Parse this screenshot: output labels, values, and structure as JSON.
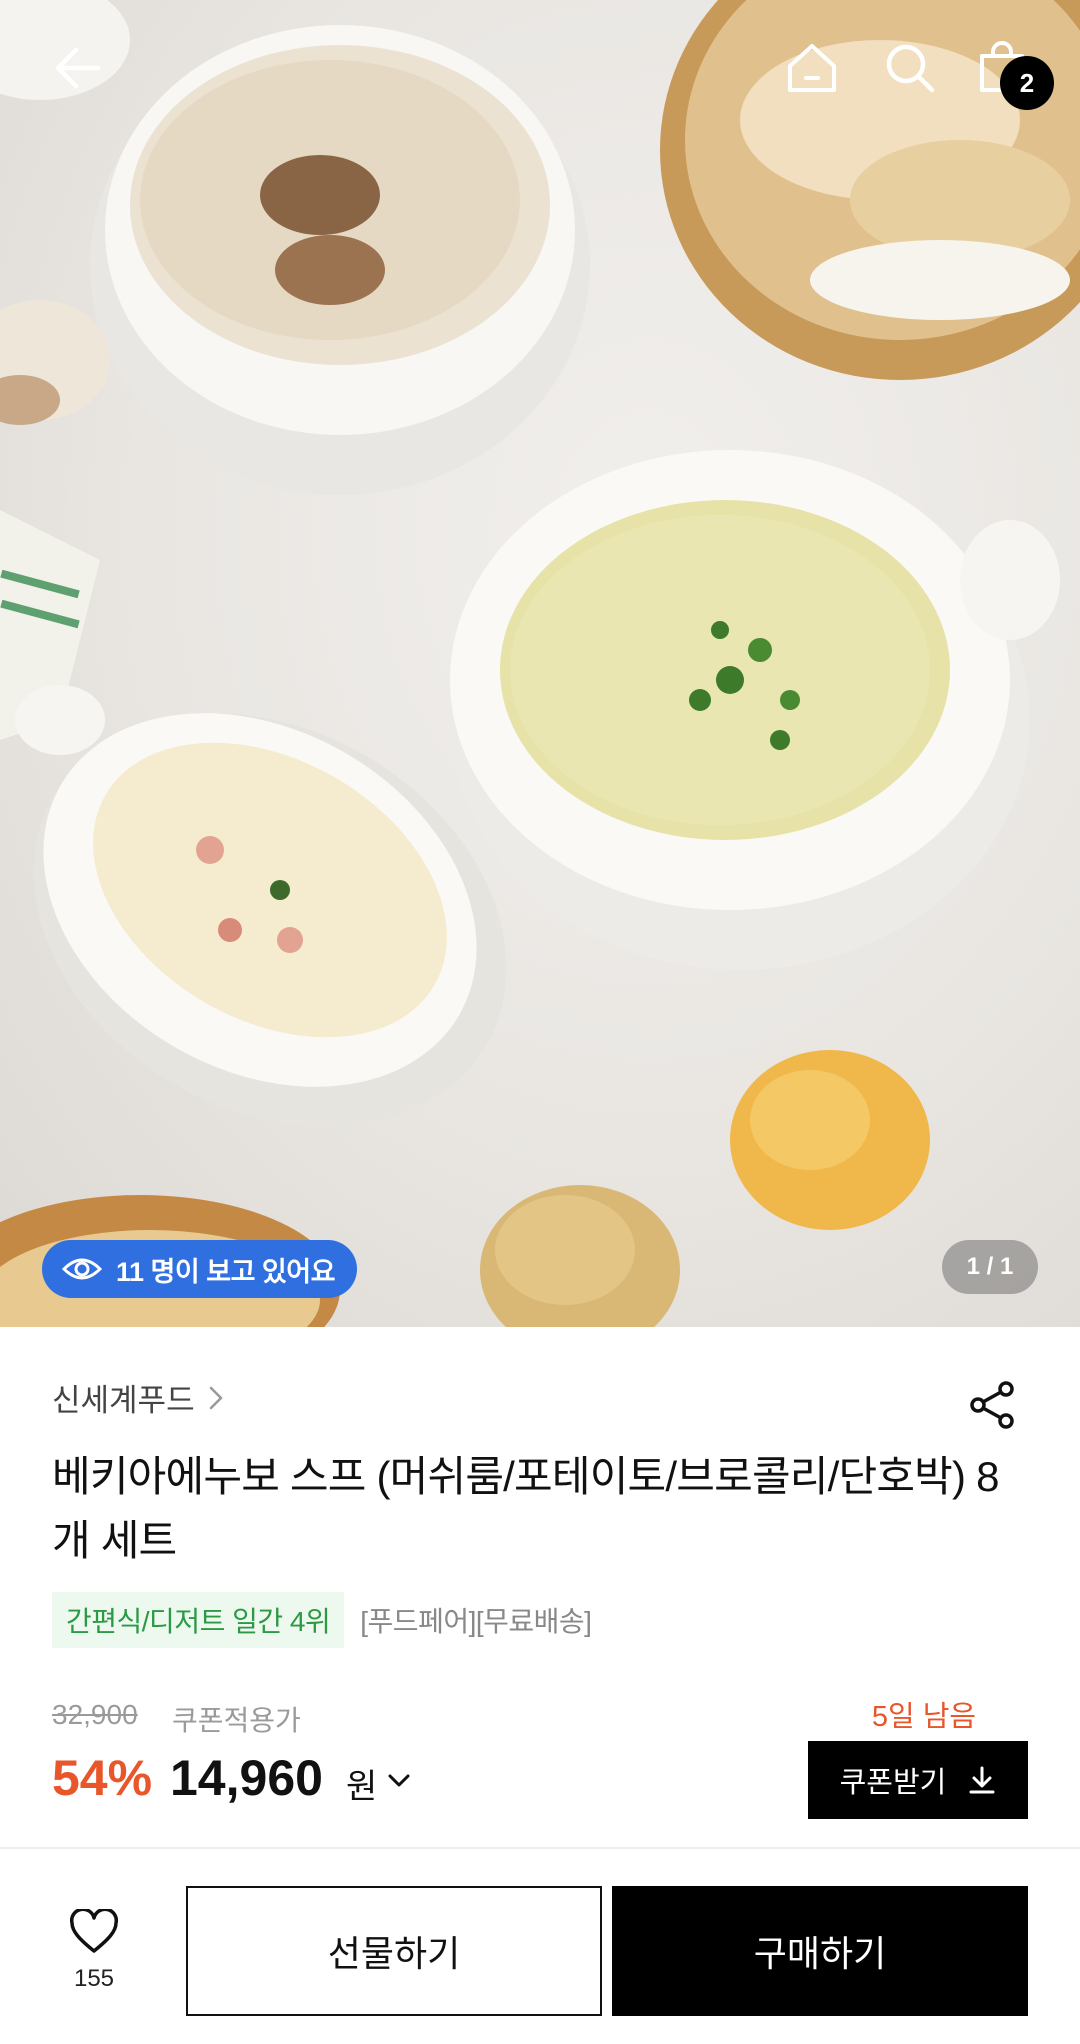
{
  "header": {
    "cart_count": "2"
  },
  "hero": {
    "viewers_text": "11 명이 보고 있어요",
    "pager": "1 / 1"
  },
  "product": {
    "brand": "신세계푸드",
    "title": "베키아에누보 스프 (머쉬룸/포테이토/브로콜리/단호박) 8개 세트",
    "rank_badge": "간편식/디저트 일간 4위",
    "tags": "[푸드페어][무료배송]"
  },
  "price": {
    "original": "32,900",
    "coupon_label": "쿠폰적용가",
    "discount": "54%",
    "final": "14,960",
    "unit": "원",
    "days_left": "5일 남음",
    "coupon_button": "쿠폰받기"
  },
  "bottom_bar": {
    "like_count": "155",
    "gift_button": "선물하기",
    "buy_button": "구매하기"
  },
  "colors": {
    "accent_orange": "#e8562a",
    "badge_green": "#2c9a45",
    "viewer_blue": "#2f6fe0",
    "black": "#000000"
  },
  "icons": [
    "back-arrow-icon",
    "home-icon",
    "search-icon",
    "cart-icon",
    "eye-icon",
    "chevron-right-icon",
    "share-icon",
    "chevron-down-icon",
    "download-icon",
    "heart-icon"
  ]
}
